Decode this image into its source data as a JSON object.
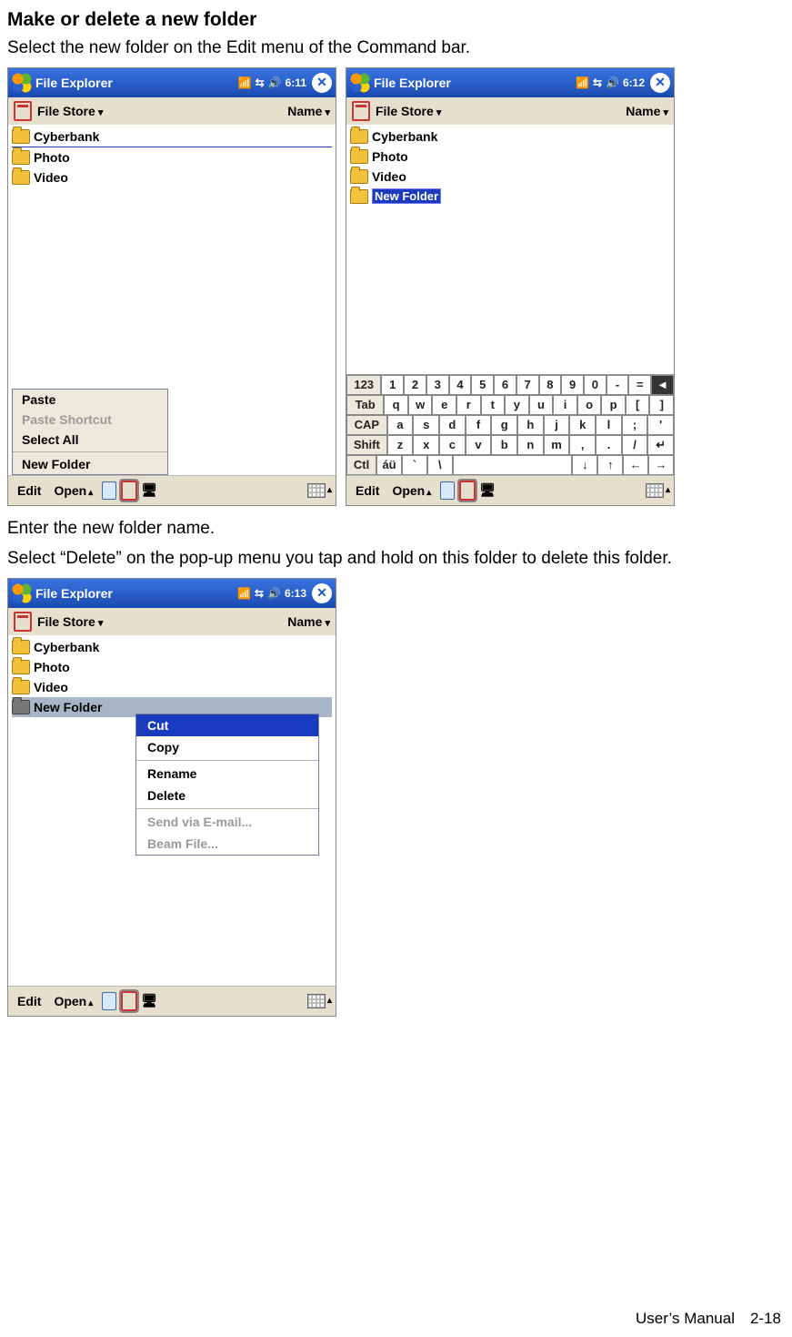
{
  "page": {
    "heading": "Make or delete a new folder",
    "intro": "Select the new folder on the Edit menu of the Command bar.",
    "mid1": "Enter the new folder name.",
    "mid2": "Select “Delete” on the pop-up menu you tap and hold on this folder to delete this folder.",
    "footer": "User’s Manual　2-18"
  },
  "shot1": {
    "title": "File Explorer",
    "time": "6:11",
    "location": "File Store",
    "sort": "Name",
    "folders": [
      "Cyberbank",
      "Photo",
      "Video"
    ],
    "editmenu": {
      "paste": "Paste",
      "paste_shortcut": "Paste Shortcut",
      "select_all": "Select All",
      "new_folder": "New Folder"
    },
    "cmd": {
      "edit": "Edit",
      "open": "Open"
    }
  },
  "shot2": {
    "title": "File Explorer",
    "time": "6:12",
    "location": "File Store",
    "sort": "Name",
    "folders": [
      "Cyberbank",
      "Photo",
      "Video"
    ],
    "new_folder_edit": "New Folder",
    "osk": {
      "r1": [
        "123",
        "1",
        "2",
        "3",
        "4",
        "5",
        "6",
        "7",
        "8",
        "9",
        "0",
        "-",
        "=",
        "◄"
      ],
      "r2": [
        "Tab",
        "q",
        "w",
        "e",
        "r",
        "t",
        "y",
        "u",
        "i",
        "o",
        "p",
        "[",
        "]"
      ],
      "r3": [
        "CAP",
        "a",
        "s",
        "d",
        "f",
        "g",
        "h",
        "j",
        "k",
        "l",
        ";",
        "'"
      ],
      "r4": [
        "Shift",
        "z",
        "x",
        "c",
        "v",
        "b",
        "n",
        "m",
        ",",
        ".",
        "/",
        "↵"
      ],
      "r5": [
        "Ctl",
        "áü",
        "`",
        "\\",
        " ",
        "↓",
        "↑",
        "←",
        "→"
      ]
    },
    "cmd": {
      "edit": "Edit",
      "open": "Open"
    }
  },
  "shot3": {
    "title": "File Explorer",
    "time": "6:13",
    "location": "File Store",
    "sort": "Name",
    "folders": [
      "Cyberbank",
      "Photo",
      "Video"
    ],
    "selected": "New Folder",
    "ctx": {
      "cut": "Cut",
      "copy": "Copy",
      "rename": "Rename",
      "delete": "Delete",
      "send": "Send via E-mail...",
      "beam": "Beam File..."
    },
    "cmd": {
      "edit": "Edit",
      "open": "Open"
    }
  }
}
